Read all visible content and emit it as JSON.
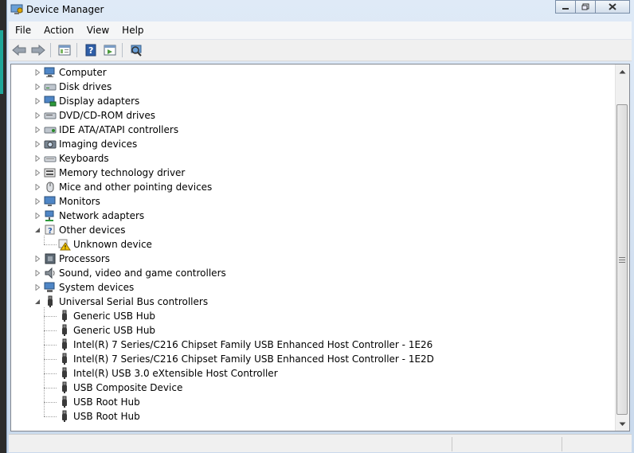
{
  "window": {
    "title": "Device Manager"
  },
  "menu": [
    "File",
    "Action",
    "View",
    "Help"
  ],
  "toolbar_icons": [
    "back-arrow-icon",
    "forward-arrow-icon",
    "properties-icon",
    "help-icon",
    "update-driver-icon",
    "scan-hardware-icon"
  ],
  "tree": {
    "categories": [
      {
        "label": "Computer",
        "icon": "computer-icon",
        "expanded": false
      },
      {
        "label": "Disk drives",
        "icon": "disk-drive-icon",
        "expanded": false
      },
      {
        "label": "Display adapters",
        "icon": "display-adapter-icon",
        "expanded": false
      },
      {
        "label": "DVD/CD-ROM drives",
        "icon": "dvd-drive-icon",
        "expanded": false
      },
      {
        "label": "IDE ATA/ATAPI controllers",
        "icon": "ide-controller-icon",
        "expanded": false
      },
      {
        "label": "Imaging devices",
        "icon": "camera-icon",
        "expanded": false
      },
      {
        "label": "Keyboards",
        "icon": "keyboard-icon",
        "expanded": false
      },
      {
        "label": "Memory technology driver",
        "icon": "memory-icon",
        "expanded": false
      },
      {
        "label": "Mice and other pointing devices",
        "icon": "mouse-icon",
        "expanded": false
      },
      {
        "label": "Monitors",
        "icon": "monitor-icon",
        "expanded": false
      },
      {
        "label": "Network adapters",
        "icon": "network-icon",
        "expanded": false
      },
      {
        "label": "Other devices",
        "icon": "other-devices-icon",
        "expanded": true,
        "children": [
          {
            "label": "Unknown device",
            "icon": "warning-device-icon"
          }
        ]
      },
      {
        "label": "Processors",
        "icon": "processor-icon",
        "expanded": false
      },
      {
        "label": "Sound, video and game controllers",
        "icon": "speaker-icon",
        "expanded": false
      },
      {
        "label": "System devices",
        "icon": "system-devices-icon",
        "expanded": false
      },
      {
        "label": "Universal Serial Bus controllers",
        "icon": "usb-icon",
        "expanded": true,
        "children": [
          {
            "label": "Generic USB Hub",
            "icon": "usb-icon"
          },
          {
            "label": "Generic USB Hub",
            "icon": "usb-icon"
          },
          {
            "label": "Intel(R) 7 Series/C216 Chipset Family USB Enhanced Host Controller - 1E26",
            "icon": "usb-icon"
          },
          {
            "label": "Intel(R) 7 Series/C216 Chipset Family USB Enhanced Host Controller - 1E2D",
            "icon": "usb-icon"
          },
          {
            "label": "Intel(R) USB 3.0 eXtensible Host Controller",
            "icon": "usb-icon"
          },
          {
            "label": "USB Composite Device",
            "icon": "usb-icon"
          },
          {
            "label": "USB Root Hub",
            "icon": "usb-icon"
          },
          {
            "label": "USB Root Hub",
            "icon": "usb-icon"
          }
        ]
      }
    ]
  },
  "colors": {
    "frame": "#cfdff0",
    "warning": "#f3c300",
    "usb": "#333333"
  }
}
